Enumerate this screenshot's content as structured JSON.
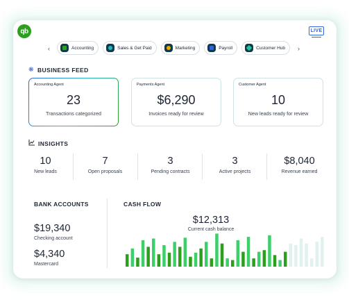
{
  "app": {
    "logo_text": "qb",
    "live_badge": "LIVE"
  },
  "nav": {
    "prev": "‹",
    "next": "›",
    "tabs": [
      {
        "label": "Accounting",
        "icon": "accounting-icon",
        "color": "#2ca01c"
      },
      {
        "label": "Sales & Get Paid",
        "icon": "sales-icon",
        "color": "#21b8c6"
      },
      {
        "label": "Marketing",
        "icon": "marketing-icon",
        "color": "#f2a900"
      },
      {
        "label": "Payroll",
        "icon": "payroll-icon",
        "color": "#2f63e0"
      },
      {
        "label": "Customer Hub",
        "icon": "customer-hub-icon",
        "color": "#21c69a"
      }
    ]
  },
  "business_feed": {
    "title": "BUSINESS FEED",
    "agents": [
      {
        "label": "Accounting Agent",
        "value": "23",
        "sub": "Transactions categorized"
      },
      {
        "label": "Payments Agent",
        "value": "$6,290",
        "sub": "Invoices ready for review"
      },
      {
        "label": "Customer Agent",
        "value": "10",
        "sub": "New leads ready for review"
      }
    ]
  },
  "insights": {
    "title": "INSIGHTS",
    "items": [
      {
        "value": "10",
        "label": "New leads"
      },
      {
        "value": "7",
        "label": "Open proposals"
      },
      {
        "value": "3",
        "label": "Pending contracts"
      },
      {
        "value": "3",
        "label": "Active projects"
      },
      {
        "value": "$8,040",
        "label": "Revenue earned"
      }
    ]
  },
  "bank_accounts": {
    "title": "BANK ACCOUNTS",
    "accounts": [
      {
        "value": "$19,340",
        "label": "Checking account"
      },
      {
        "value": "$4,340",
        "label": "Mastercard"
      }
    ]
  },
  "cash_flow": {
    "title": "CASH FLOW",
    "value": "$12,313",
    "label": "Current cash balance"
  },
  "colors": {
    "brand_green": "#2ca01c",
    "accent_blue": "#2f63e0",
    "faded_bar": "#e1f1f0"
  },
  "chart_data": {
    "type": "bar",
    "title": "",
    "series": [
      {
        "values": [
          15,
          22,
          11,
          32,
          24,
          34,
          15,
          26,
          17,
          30,
          24,
          35,
          12,
          17,
          22,
          30,
          10,
          40,
          28,
          10,
          8,
          32,
          18,
          36,
          10,
          18,
          20,
          38,
          14,
          8,
          18,
          28,
          26,
          34,
          28,
          10,
          30,
          36
        ]
      }
    ],
    "highlighted_count": 31
  }
}
